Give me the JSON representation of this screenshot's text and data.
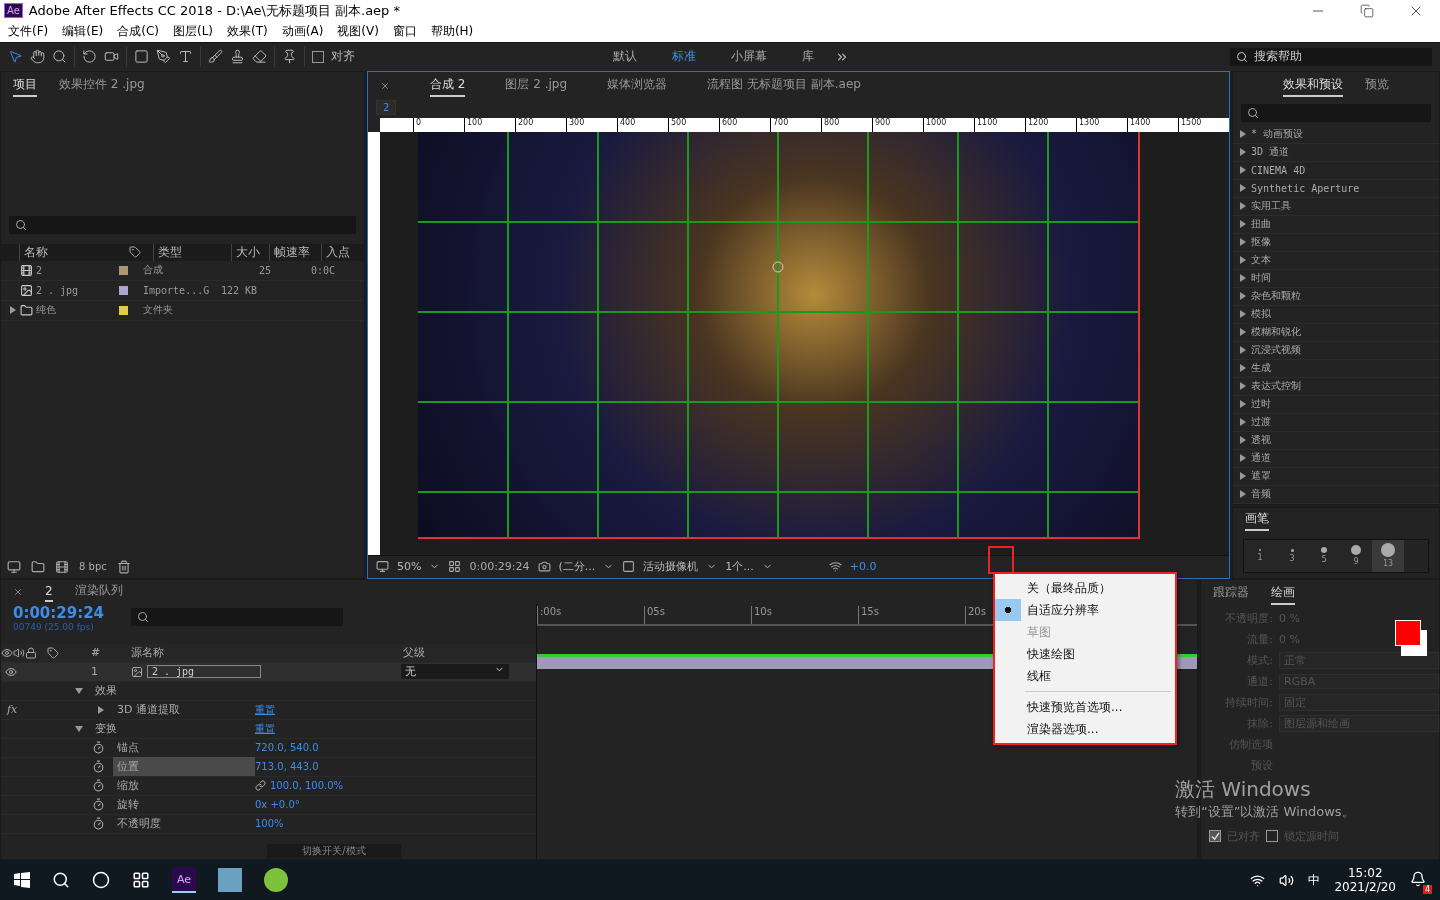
{
  "window": {
    "app_badge": "Ae",
    "title": "Adobe After Effects CC 2018 - D:\\Ae\\无标题项目 副本.aep *"
  },
  "menu": [
    "文件(F)",
    "编辑(E)",
    "合成(C)",
    "图层(L)",
    "效果(T)",
    "动画(A)",
    "视图(V)",
    "窗口",
    "帮助(H)"
  ],
  "toolbar": {
    "snap_label": "对齐",
    "snap_checked": false,
    "workspaces": [
      {
        "label": "默认",
        "selected": false
      },
      {
        "label": "标准",
        "selected": true
      },
      {
        "label": "小屏幕",
        "selected": false
      },
      {
        "label": "库",
        "selected": false
      }
    ],
    "search_placeholder": "搜索帮助"
  },
  "project_panel": {
    "tabs": [
      {
        "label": "项目",
        "selected": true
      },
      {
        "label": "效果控件 2 .jpg",
        "selected": false
      }
    ],
    "columns": [
      "名称",
      "类型",
      "大小",
      "帧速率",
      "入点"
    ],
    "rows": [
      {
        "kind": "comp",
        "name": "2",
        "color": "#a99878",
        "type": "合成",
        "frame_rate": "25",
        "in_point": "0:0C"
      },
      {
        "kind": "image",
        "name": "2 . jpg",
        "color": "#aaa6d0",
        "type": "Importe...G",
        "size": "122 KB"
      },
      {
        "kind": "folder",
        "name": "纯色",
        "color": "#e0cf3a",
        "type": "文件夹"
      }
    ],
    "bpc": "8 bpc"
  },
  "viewer": {
    "tabs": [
      {
        "label": "合成 2",
        "selected": true
      },
      {
        "label": "图层 2 .jpg",
        "selected": false
      },
      {
        "label": "媒体浏览器",
        "selected": false
      },
      {
        "label": "流程图 无标题项目 副本.aep",
        "selected": false
      }
    ],
    "breadcrumb": "2",
    "ruler": [
      "0",
      "100",
      "200",
      "300",
      "400",
      "500",
      "600",
      "700",
      "800",
      "900",
      "1000",
      "1100",
      "1200",
      "1300",
      "1400",
      "1500"
    ],
    "zoom": "50%",
    "timecode": "0:00:29:24",
    "resolution": "(二分...",
    "camera": "活动摄像机",
    "views": "1个...",
    "exposure": "+0.0"
  },
  "effects_panel": {
    "tabs": [
      {
        "label": "效果和预设",
        "selected": true
      },
      {
        "label": "预览",
        "selected": false
      }
    ],
    "items": [
      "* 动画预设",
      "3D 通道",
      "CINEMA 4D",
      "Synthetic Aperture",
      "实用工具",
      "扭曲",
      "抠像",
      "文本",
      "时间",
      "杂色和颗粒",
      "模拟",
      "模糊和锐化",
      "沉浸式视频",
      "生成",
      "表达式控制",
      "过时",
      "过渡",
      "透视",
      "通道",
      "遮罩",
      "音频"
    ]
  },
  "brush_panel": {
    "title": "画笔",
    "tips": [
      {
        "size": "1",
        "selected": false
      },
      {
        "size": "3",
        "selected": false
      },
      {
        "size": "5",
        "selected": false
      },
      {
        "size": "9",
        "selected": false
      },
      {
        "size": "13",
        "selected": true
      }
    ]
  },
  "timeline": {
    "tabs": [
      {
        "label": "2",
        "selected": true
      },
      {
        "label": "渲染队列",
        "selected": false
      }
    ],
    "timecode": "0:00:29:24",
    "frame_info": "00749 (25.00 fps)",
    "columns": {
      "number": "#",
      "source": "源名称",
      "parent": "父级"
    },
    "layer": {
      "number": "1",
      "name": "2 . jpg",
      "parent": "无"
    },
    "properties": [
      {
        "label": "效果",
        "expanded": true,
        "children": [
          {
            "label": "3D 通道提取",
            "expanded": false,
            "value": "重置",
            "badge": "fx"
          }
        ]
      },
      {
        "label": "变换",
        "expanded": true,
        "value": "重置",
        "children": [
          {
            "label": "锚点",
            "value": "720.0, 540.0",
            "selected": false
          },
          {
            "label": "位置",
            "value": "713.0, 443.0",
            "selected": true
          },
          {
            "label": "缩放",
            "value": "100.0, 100.0%",
            "linked": true,
            "selected": false
          },
          {
            "label": "旋转",
            "value": "0x +0.0°",
            "selected": false
          },
          {
            "label": "不透明度",
            "value": "100%",
            "selected": false
          }
        ]
      }
    ],
    "time_labels": [
      ":00s",
      "05s",
      "10s",
      "15s",
      "20s"
    ],
    "footer": "切换开关/模式"
  },
  "paint_panel": {
    "tabs": [
      {
        "label": "跟踪器",
        "selected": false
      },
      {
        "label": "绘画",
        "selected": true
      }
    ],
    "disabled": true,
    "fields": [
      {
        "kind": "number",
        "label": "不透明度:",
        "value": "0 %"
      },
      {
        "kind": "number",
        "label": "流量:",
        "value": "0 %"
      },
      {
        "kind": "select",
        "label": "模式:",
        "value": "正常"
      },
      {
        "kind": "select",
        "label": "通道:",
        "value": "RGBA"
      },
      {
        "kind": "select",
        "label": "持续时间:",
        "value": "固定"
      },
      {
        "kind": "select",
        "label": "抹除:",
        "value": "图层源和绘画"
      }
    ],
    "clone_title": "仿制选项",
    "clone_label": "预设",
    "checks": [
      {
        "label": "已对齐",
        "checked": true
      },
      {
        "label": "锁定源时间",
        "checked": false
      }
    ]
  },
  "popup_menu": {
    "groups": [
      [
        {
          "label": "关（最终品质）",
          "selected": false,
          "disabled": false
        },
        {
          "label": "自适应分辨率",
          "selected": true,
          "disabled": false
        },
        {
          "label": "草图",
          "selected": false,
          "disabled": true
        },
        {
          "label": "快速绘图",
          "selected": false,
          "disabled": false
        },
        {
          "label": "线框",
          "selected": false,
          "disabled": false
        }
      ],
      [
        {
          "label": "快速预览首选项...",
          "selected": false,
          "disabled": false
        },
        {
          "label": "渲染器选项...",
          "selected": false,
          "disabled": false
        }
      ]
    ]
  },
  "activation": {
    "title": "激活 Windows",
    "subtitle": "转到“设置”以激活 Windows。"
  },
  "taskbar": {
    "ae_label": "Ae",
    "ime": "中",
    "badge": "4",
    "time": "15:02",
    "date": "2021/2/20"
  }
}
